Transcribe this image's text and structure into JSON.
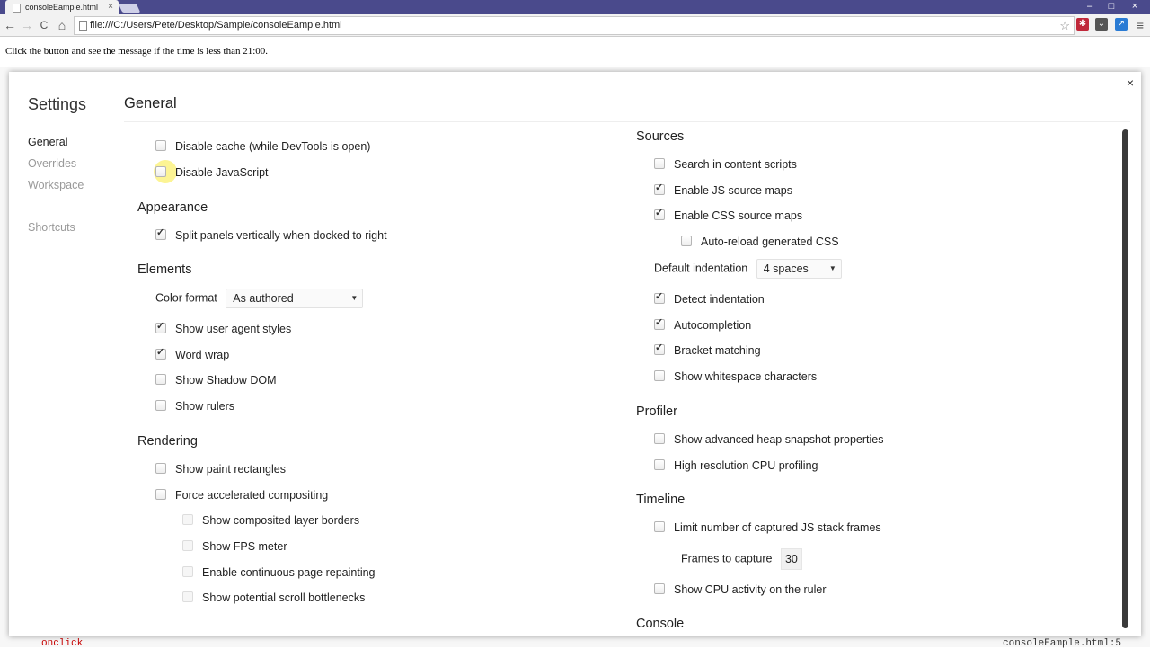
{
  "browser": {
    "tab_title": "consoleEample.html",
    "tab_close": "×",
    "url": "file:///C:/Users/Pete/Desktop/Sample/consoleEample.html",
    "back": "←",
    "forward": "→",
    "reload": "C",
    "home": "⌂",
    "window_controls": [
      "–",
      "□",
      "×"
    ]
  },
  "page": {
    "message": "Click the button and see the message if the time is less than 21:00."
  },
  "devtools_behind": {
    "left_text": "onclick",
    "right_text": "consoleEample.html:5"
  },
  "settings": {
    "title": "Settings",
    "close": "×",
    "nav": [
      "General",
      "Overrides",
      "Workspace",
      "Shortcuts"
    ],
    "section_title": "General",
    "left": {
      "general_items": [
        {
          "label": "Disable cache (while DevTools is open)",
          "checked": false
        },
        {
          "label": "Disable JavaScript",
          "checked": false
        }
      ],
      "appearance_title": "Appearance",
      "appearance_items": [
        {
          "label": "Split panels vertically when docked to right",
          "checked": true
        }
      ],
      "elements_title": "Elements",
      "color_format_label": "Color format",
      "color_format_value": "As authored",
      "elements_items": [
        {
          "label": "Show user agent styles",
          "checked": true
        },
        {
          "label": "Word wrap",
          "checked": true
        },
        {
          "label": "Show Shadow DOM",
          "checked": false
        },
        {
          "label": "Show rulers",
          "checked": false
        }
      ],
      "rendering_title": "Rendering",
      "rendering_items": [
        {
          "label": "Show paint rectangles",
          "checked": false
        },
        {
          "label": "Force accelerated compositing",
          "checked": false
        }
      ],
      "rendering_sub_items": [
        {
          "label": "Show composited layer borders",
          "checked": false
        },
        {
          "label": "Show FPS meter",
          "checked": false
        },
        {
          "label": "Enable continuous page repainting",
          "checked": false
        },
        {
          "label": "Show potential scroll bottlenecks",
          "checked": false
        }
      ]
    },
    "right": {
      "sources_title": "Sources",
      "sources_items": [
        {
          "label": "Search in content scripts",
          "checked": false
        },
        {
          "label": "Enable JS source maps",
          "checked": true
        },
        {
          "label": "Enable CSS source maps",
          "checked": true
        }
      ],
      "sources_sub_item": {
        "label": "Auto-reload generated CSS",
        "checked": false
      },
      "indent_label": "Default indentation",
      "indent_value": "4 spaces",
      "sources_items2": [
        {
          "label": "Detect indentation",
          "checked": true
        },
        {
          "label": "Autocompletion",
          "checked": true
        },
        {
          "label": "Bracket matching",
          "checked": true
        },
        {
          "label": "Show whitespace characters",
          "checked": false
        }
      ],
      "profiler_title": "Profiler",
      "profiler_items": [
        {
          "label": "Show advanced heap snapshot properties",
          "checked": false
        },
        {
          "label": "High resolution CPU profiling",
          "checked": false
        }
      ],
      "timeline_title": "Timeline",
      "timeline_item": {
        "label": "Limit number of captured JS stack frames",
        "checked": false
      },
      "frames_label": "Frames to capture",
      "frames_value": "30",
      "timeline_item2": {
        "label": "Show CPU activity on the ruler",
        "checked": false
      },
      "console_title": "Console"
    }
  }
}
